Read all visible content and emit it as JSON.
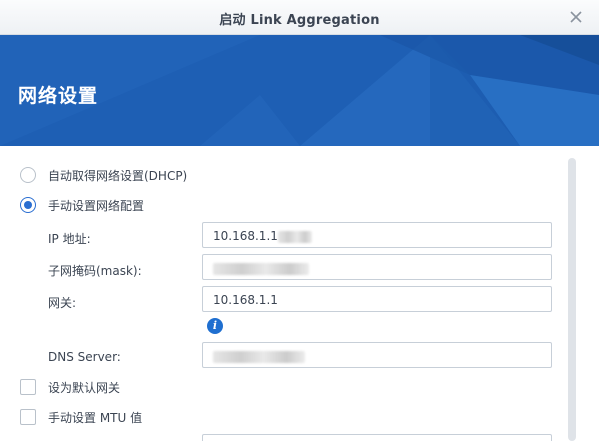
{
  "window": {
    "title": "启动 Link Aggregation",
    "close_icon": "close-icon"
  },
  "banner": {
    "title": "网络设置",
    "color": "#1f5fb3"
  },
  "network_mode": {
    "options": [
      {
        "label": "自动取得网络设置(DHCP)",
        "selected": false
      },
      {
        "label": "手动设置网络配置",
        "selected": true
      }
    ]
  },
  "fields": {
    "ip": {
      "label": "IP 地址:",
      "value": "10.168.1.1"
    },
    "mask": {
      "label": "子网掩码(mask):",
      "value": ""
    },
    "gateway": {
      "label": "网关:",
      "value": "10.168.1.1"
    },
    "dns": {
      "label": "DNS Server:",
      "value": ""
    }
  },
  "info_icon": "info-icon",
  "checkboxes": {
    "default_gateway": {
      "label": "设为默认网关",
      "checked": false
    },
    "manual_mtu": {
      "label": "手动设置 MTU 值",
      "checked": false
    }
  },
  "accent_color": "#2a6ed1"
}
